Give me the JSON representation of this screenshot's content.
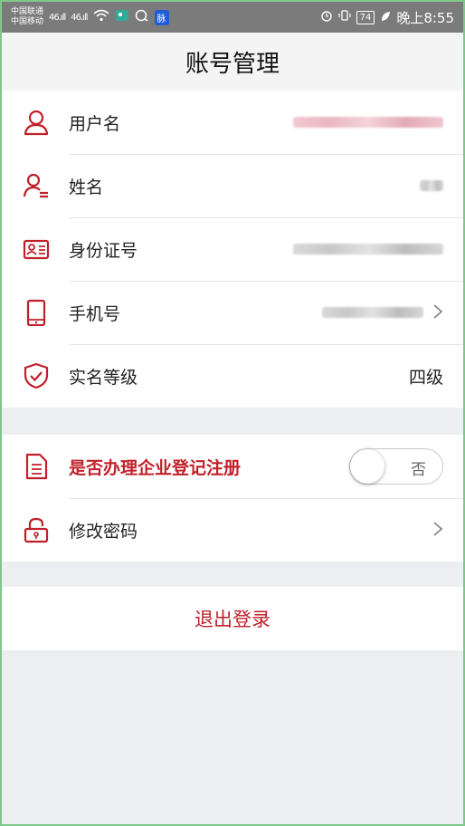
{
  "status_bar": {
    "carrier_line1": "中国联通",
    "carrier_line2": "中国移动",
    "signal1": "46.ıll",
    "signal2": "46.ıll",
    "app_badge": "脉",
    "battery": "74",
    "time": "晚上8:55"
  },
  "header": {
    "title": "账号管理"
  },
  "colors": {
    "accent": "#c0202a",
    "background": "#eceef1"
  },
  "rows": [
    {
      "icon": "user-icon",
      "label": "用户名",
      "value_blurred": true
    },
    {
      "icon": "contact-icon",
      "label": "姓名",
      "value_blurred": true
    },
    {
      "icon": "id-card-icon",
      "label": "身份证号",
      "value_blurred": true
    },
    {
      "icon": "phone-icon",
      "label": "手机号",
      "value_blurred": true
    },
    {
      "icon": "shield-check-icon",
      "label": "实名等级",
      "value": "四级"
    }
  ],
  "settings": [
    {
      "icon": "document-icon",
      "label": "是否办理企业登记注册",
      "toggle_text": "否",
      "toggle_on": false
    },
    {
      "icon": "lock-icon",
      "label": "修改密码"
    }
  ],
  "logout_label": "退出登录"
}
